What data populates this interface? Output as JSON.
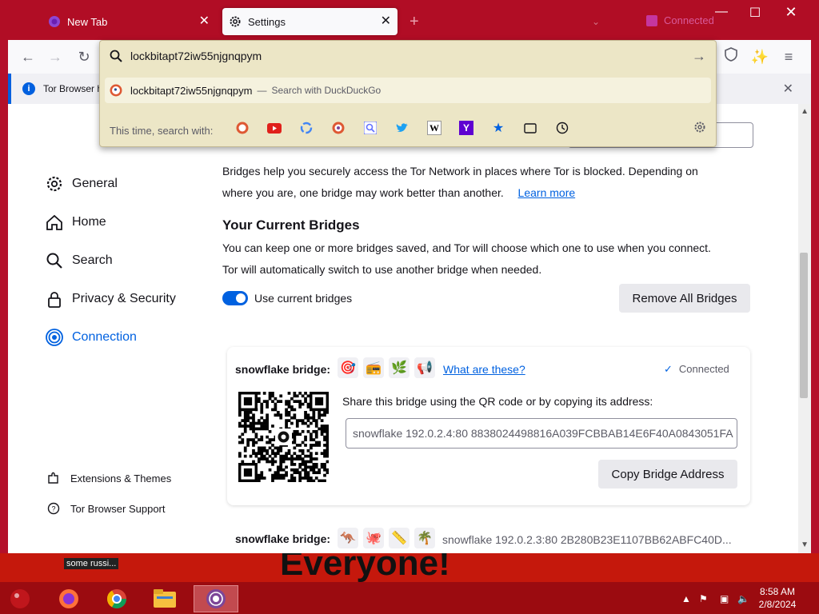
{
  "tabs": [
    {
      "label": "New Tab"
    },
    {
      "label": "Settings"
    }
  ],
  "tor_status": {
    "label": "Connected"
  },
  "notification": {
    "text": "Tor Browser h"
  },
  "urlbar": {
    "value": "lockbitapt72iw55njgnqpym",
    "suggestion_text": "lockbitapt72iw55njgnqpym",
    "suggestion_separator": "—",
    "suggestion_action": "Search with DuckDuckGo",
    "one_off_label": "This time, search with:",
    "engines": [
      "duckduckgo-icon",
      "youtube-icon",
      "google-icon",
      "duckduckgo-onion-icon",
      "startpage-icon",
      "twitter-icon",
      "wikipedia-icon",
      "yahoo-icon",
      "bookmarks-icon",
      "tabs-icon",
      "history-icon"
    ]
  },
  "sidebar": {
    "items": [
      {
        "label": "General",
        "icon": "gear-icon"
      },
      {
        "label": "Home",
        "icon": "home-icon"
      },
      {
        "label": "Search",
        "icon": "search-icon"
      },
      {
        "label": "Privacy & Security",
        "icon": "lock-icon"
      },
      {
        "label": "Connection",
        "icon": "connection-icon",
        "active": true
      }
    ],
    "footer": [
      {
        "label": "Extensions & Themes",
        "icon": "puzzle-icon"
      },
      {
        "label": "Tor Browser Support",
        "icon": "help-icon"
      }
    ]
  },
  "main": {
    "intro_line1": "Bridges help you securely access the Tor Network in places where Tor is blocked. Depending on",
    "intro_line2": "where you are, one bridge may work better than another.",
    "learn_more": "Learn more",
    "current_bridges_heading": "Your Current Bridges",
    "current_bridges_desc1": "You can keep one or more bridges saved, and Tor will choose which one to use when you connect.",
    "current_bridges_desc2": "Tor will automatically switch to use another bridge when needed.",
    "use_current_bridges": "Use current bridges",
    "use_current_bridges_on": true,
    "remove_all_bridges": "Remove All Bridges",
    "bridge1": {
      "title": "snowflake bridge:",
      "emojis": [
        "🎯",
        "📻",
        "🌿",
        "📢"
      ],
      "what_are_these": "What are these?",
      "status": "Connected",
      "share_text": "Share this bridge using the QR code or by copying its address:",
      "address": "snowflake 192.0.2.4:80 8838024498816A039FCBBAB14E6F40A0843051FA",
      "copy_button": "Copy Bridge Address"
    },
    "bridge2": {
      "title": "snowflake bridge:",
      "emojis": [
        "🦘",
        "🐙",
        "📏",
        "🌴"
      ],
      "address": "snowflake 192.0.2.3:80 2B280B23E1107BB62ABFC40D..."
    }
  },
  "desktop": {
    "banner_text": "Everyone!",
    "note_text": "some russi..."
  },
  "taskbar": {
    "time": "8:58 AM",
    "date": "2/8/2024"
  },
  "colors": {
    "accent": "#0061e0",
    "window_frame": "#b10d25",
    "urlbar_bg": "#ece6c6"
  }
}
